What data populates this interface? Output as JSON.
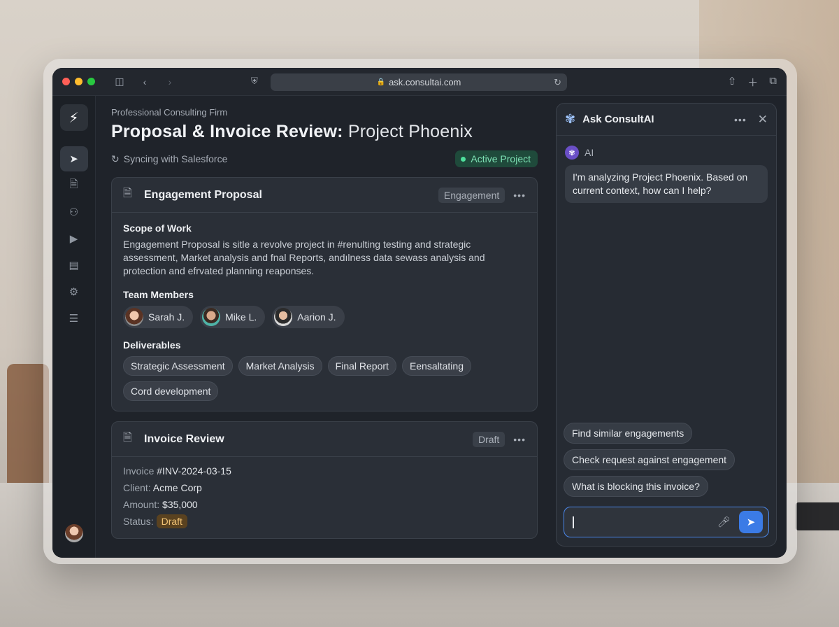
{
  "browser": {
    "url": "ask.consultai.com"
  },
  "header": {
    "subtitle": "Professional Consulting Firm",
    "title_bold": "Proposal & Invoice Review:",
    "title_rest": " Project Phoenix",
    "sync_status": "Syncing with Salesforce",
    "project_badge": "Active Project"
  },
  "proposal": {
    "title": "Engagement Proposal",
    "tag": "Engagement",
    "scope_heading": "Scope of Work",
    "scope_text": "Engagement Proposal is sitle a revolve project in #renulting testing and strategic assessment, Market analysis and fnal Reports, andılness data sewass analysis and protection and efrvated planning reaponses.",
    "team_heading": "Team Members",
    "members": [
      {
        "name": "Sarah J."
      },
      {
        "name": "Mike L."
      },
      {
        "name": "Aarion J."
      }
    ],
    "deliverables_heading": "Deliverables",
    "deliverables": [
      "Strategic Assessment",
      "Market Analysis",
      "Final Report",
      "Eensaltating",
      "Cord development"
    ]
  },
  "invoice": {
    "title": "Invoice Review",
    "tag": "Draft",
    "invoice_label": "Invoice",
    "invoice_value": " #INV-2024-03-15",
    "client_label": "Client:",
    "client_value": " Acme Corp",
    "amount_label": "Amount:",
    "amount_value": " $35,000",
    "status_label": "Status:",
    "status_value": "Draft"
  },
  "assistant": {
    "title": "Ask ConsultAI",
    "sender": "AI",
    "message": "I'm analyzing Project Phoenix. Based on current context, how can I help?",
    "suggestions": [
      "Find similar engagements",
      "Check request against engagement",
      "What is blocking this invoice?"
    ],
    "input_value": ""
  },
  "colors": {
    "accent": "#3b7be6",
    "active_green": "#4ee09c",
    "draft_amber": "#f0c274"
  }
}
